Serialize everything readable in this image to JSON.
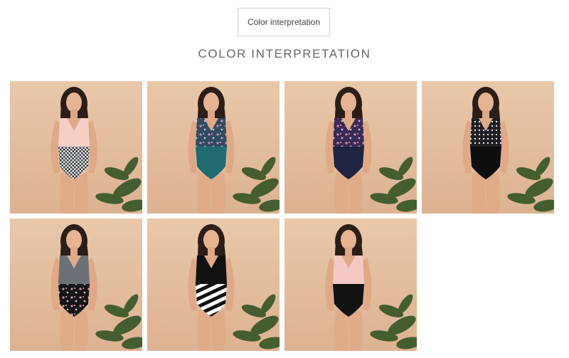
{
  "tab": {
    "label": "Color interpretation"
  },
  "section": {
    "title": "COLOR INTERPRETATION"
  },
  "gallery": {
    "items": [
      {
        "name": "pink-top-gingham-swimsuit",
        "top": "#f6cfc6",
        "bottom": "#8b8f96",
        "pattern": "gingham"
      },
      {
        "name": "floral-top-teal-swimsuit",
        "top": "#2f4c63",
        "bottom": "#1f6b70",
        "pattern": "floral-top"
      },
      {
        "name": "floral-top-navy-swimsuit",
        "top": "#3a2b55",
        "bottom": "#1f2443",
        "pattern": "floral-top"
      },
      {
        "name": "polka-dot-black-swimsuit",
        "top": "#1f1f24",
        "bottom": "#0e0e10",
        "pattern": "dots"
      },
      {
        "name": "gingham-top-floral-black-swimsuit",
        "top": "#6c7077",
        "bottom": "#151515",
        "pattern": "floral-bottom"
      },
      {
        "name": "black-top-zebra-swimsuit",
        "top": "#111111",
        "bottom": "#2a2a2a",
        "pattern": "zebra"
      },
      {
        "name": "pink-top-black-swimsuit",
        "top": "#f4c8c4",
        "bottom": "#121212",
        "pattern": "plain"
      }
    ]
  }
}
